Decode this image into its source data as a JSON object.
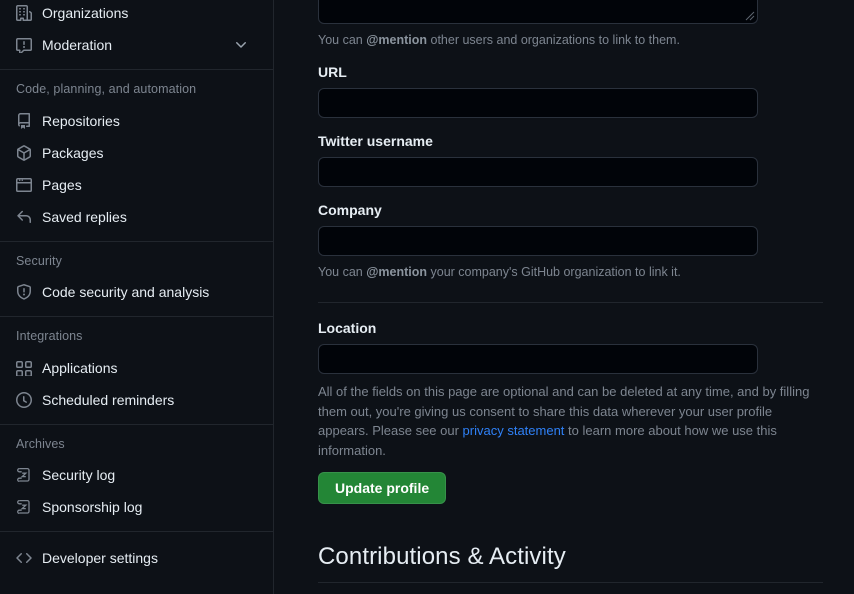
{
  "sidebar": {
    "groups": [
      {
        "title": null,
        "items": [
          {
            "label": "Organizations",
            "icon": "organization-icon",
            "chevron": false
          },
          {
            "label": "Moderation",
            "icon": "report-icon",
            "chevron": true
          }
        ]
      },
      {
        "title": "Code, planning, and automation",
        "items": [
          {
            "label": "Repositories",
            "icon": "repo-icon",
            "chevron": false
          },
          {
            "label": "Packages",
            "icon": "package-icon",
            "chevron": false
          },
          {
            "label": "Pages",
            "icon": "browser-icon",
            "chevron": false
          },
          {
            "label": "Saved replies",
            "icon": "reply-icon",
            "chevron": false
          }
        ]
      },
      {
        "title": "Security",
        "items": [
          {
            "label": "Code security and analysis",
            "icon": "shield-icon",
            "chevron": false
          }
        ]
      },
      {
        "title": "Integrations",
        "items": [
          {
            "label": "Applications",
            "icon": "apps-grid-icon",
            "chevron": false
          },
          {
            "label": "Scheduled reminders",
            "icon": "clock-icon",
            "chevron": false
          }
        ]
      },
      {
        "title": "Archives",
        "items": [
          {
            "label": "Security log",
            "icon": "log-icon",
            "chevron": false
          },
          {
            "label": "Sponsorship log",
            "icon": "log-icon",
            "chevron": false
          }
        ]
      },
      {
        "title": null,
        "items": [
          {
            "label": "Developer settings",
            "icon": "code-icon",
            "chevron": false
          }
        ]
      }
    ]
  },
  "main": {
    "bio": {
      "value": "",
      "placeholder": "",
      "help_prefix": "You can ",
      "help_mention": "@mention",
      "help_suffix": " other users and organizations to link to them."
    },
    "url": {
      "label": "URL",
      "value": "",
      "placeholder": ""
    },
    "twitter": {
      "label": "Twitter username",
      "value": "",
      "placeholder": ""
    },
    "company": {
      "label": "Company",
      "value": "",
      "placeholder": "",
      "help_prefix": "You can ",
      "help_mention": "@mention",
      "help_suffix": " your company's GitHub organization to link it."
    },
    "location": {
      "label": "Location",
      "value": "",
      "placeholder": ""
    },
    "consent": {
      "text_before_link": "All of the fields on this page are optional and can be deleted at any time, and by filling them out, you're giving us consent to share this data wherever your user profile appears. Please see our ",
      "link_text": "privacy statement",
      "text_after_link": " to learn more about how we use this information."
    },
    "submit_label": "Update profile",
    "contributions_heading": "Contributions & Activity"
  },
  "colors": {
    "page_bg": "#0d1117",
    "border": "#21262d",
    "input_bg": "#010409",
    "input_border": "#2a313c",
    "text": "#e6edf3",
    "muted": "#7d8590",
    "link": "#2f81f7",
    "btn_green": "#238636"
  }
}
